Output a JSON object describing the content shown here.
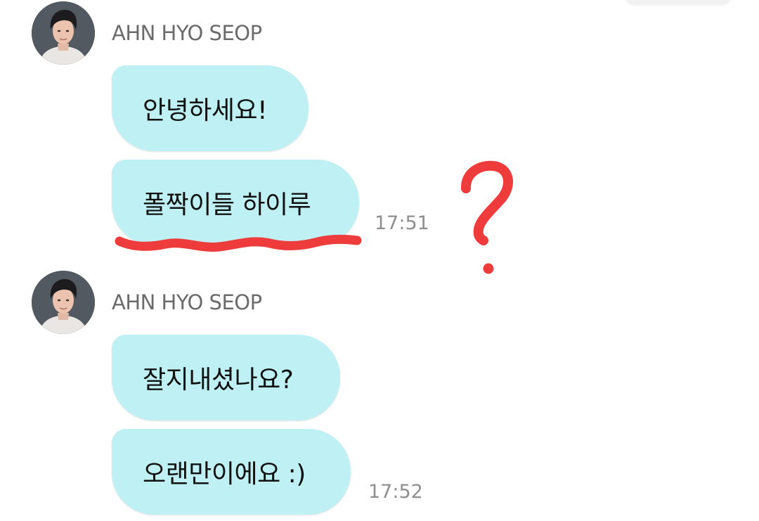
{
  "chat": {
    "groups": [
      {
        "sender": "AHN HYO SEOP",
        "messages": [
          {
            "text": "안녕하세요!"
          },
          {
            "text": "폴짝이들 하이루",
            "time": "17:51"
          }
        ]
      },
      {
        "sender": "AHN HYO SEOP",
        "messages": [
          {
            "text": "잘지내셨나요?"
          },
          {
            "text": "오랜만이에요 :)",
            "time": "17:52"
          }
        ]
      }
    ]
  },
  "colors": {
    "bubble": "#bff1f4",
    "sender_name": "#6b6b6b",
    "time": "#8f8f8f",
    "annotation_red": "#ee3b3b"
  },
  "annotations": {
    "underline_icon": "red-underline-scribble",
    "question_icon": "red-question-mark"
  }
}
